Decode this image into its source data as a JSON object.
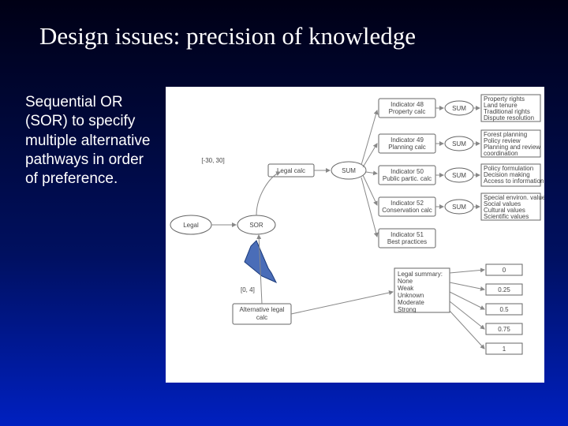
{
  "title": "Design issues: precision of knowledge",
  "body": "Sequential OR (SOR) to specify multiple alternative pathways in order of preference.",
  "diagram": {
    "inputs": {
      "legal": {
        "label": "Legal",
        "range": "[-30, 30]"
      },
      "altlegal": {
        "label": "Alternative legal\ncalc",
        "range": "[0, 4]"
      }
    },
    "sor": {
      "label": "SOR"
    },
    "legal_calc": {
      "label": "Legal calc"
    },
    "sum_center": {
      "label": "SUM"
    },
    "indicators": [
      {
        "label": "Indicator 48\nProperty calc"
      },
      {
        "label": "Indicator 49\nPlanning calc"
      },
      {
        "label": "Indicator 50\nPublic partic. calc"
      },
      {
        "label": "Indicator 52\nConservation calc"
      },
      {
        "label": "Indicator 51\nBest practices"
      }
    ],
    "indicator_sums": [
      {
        "label": "SUM"
      },
      {
        "label": "SUM"
      },
      {
        "label": "SUM"
      },
      {
        "label": "SUM"
      }
    ],
    "right_texts": [
      "Property rights\nLand tenure\nTraditional rights\nDispute resolution",
      "Forest planning\nPolicy review\nPlanning and review\ncoordination",
      "Policy formulation\nDecision making\nAccess to information",
      "Special environ. values\nSocial values\nCultural values\nScientific values"
    ],
    "summary_label": "Legal summary:\nNone\nWeak\nUnknown\nModerate\nStrong",
    "scale": [
      "0",
      "0.25",
      "0.5",
      "0.75",
      "1"
    ]
  }
}
